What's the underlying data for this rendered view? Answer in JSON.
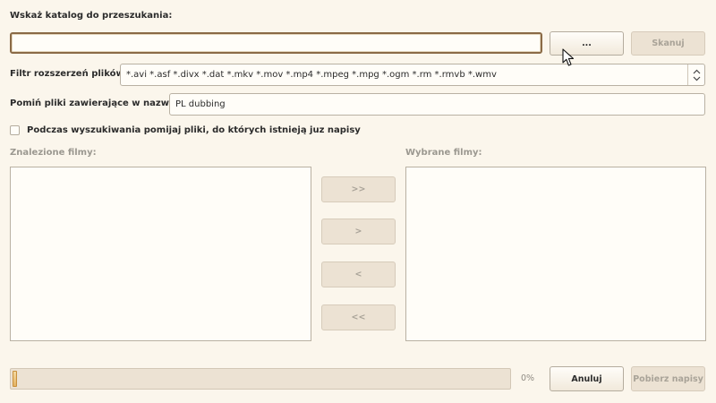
{
  "dir": {
    "label": "Wskaż katalog do przeszukania:",
    "value": "",
    "browse_label": "...",
    "scan_label": "Skanuj"
  },
  "filter": {
    "label": "Filtr rozszerzeń plików:",
    "value": "*.avi *.asf *.divx *.dat *.mkv *.mov *.mp4 *.mpeg *.mpg *.ogm *.rm *.rmvb *.wmv"
  },
  "skip": {
    "label": "Pomiń pliki zawierające w nazwie:",
    "value": "PL dubbing"
  },
  "checkbox": {
    "label": "Podczas wyszukiwania pomijaj pliki, do których istnieją juz napisy",
    "checked": false
  },
  "found": {
    "label": "Znalezione filmy:",
    "items": []
  },
  "selected": {
    "label": "Wybrane filmy:",
    "items": []
  },
  "transfer": {
    "add_all": ">>",
    "add": ">",
    "remove": "<",
    "remove_all": "<<"
  },
  "progress": {
    "value": 0,
    "text": "0%"
  },
  "actions": {
    "cancel": "Anuluj",
    "download": "Pobierz napisy"
  }
}
